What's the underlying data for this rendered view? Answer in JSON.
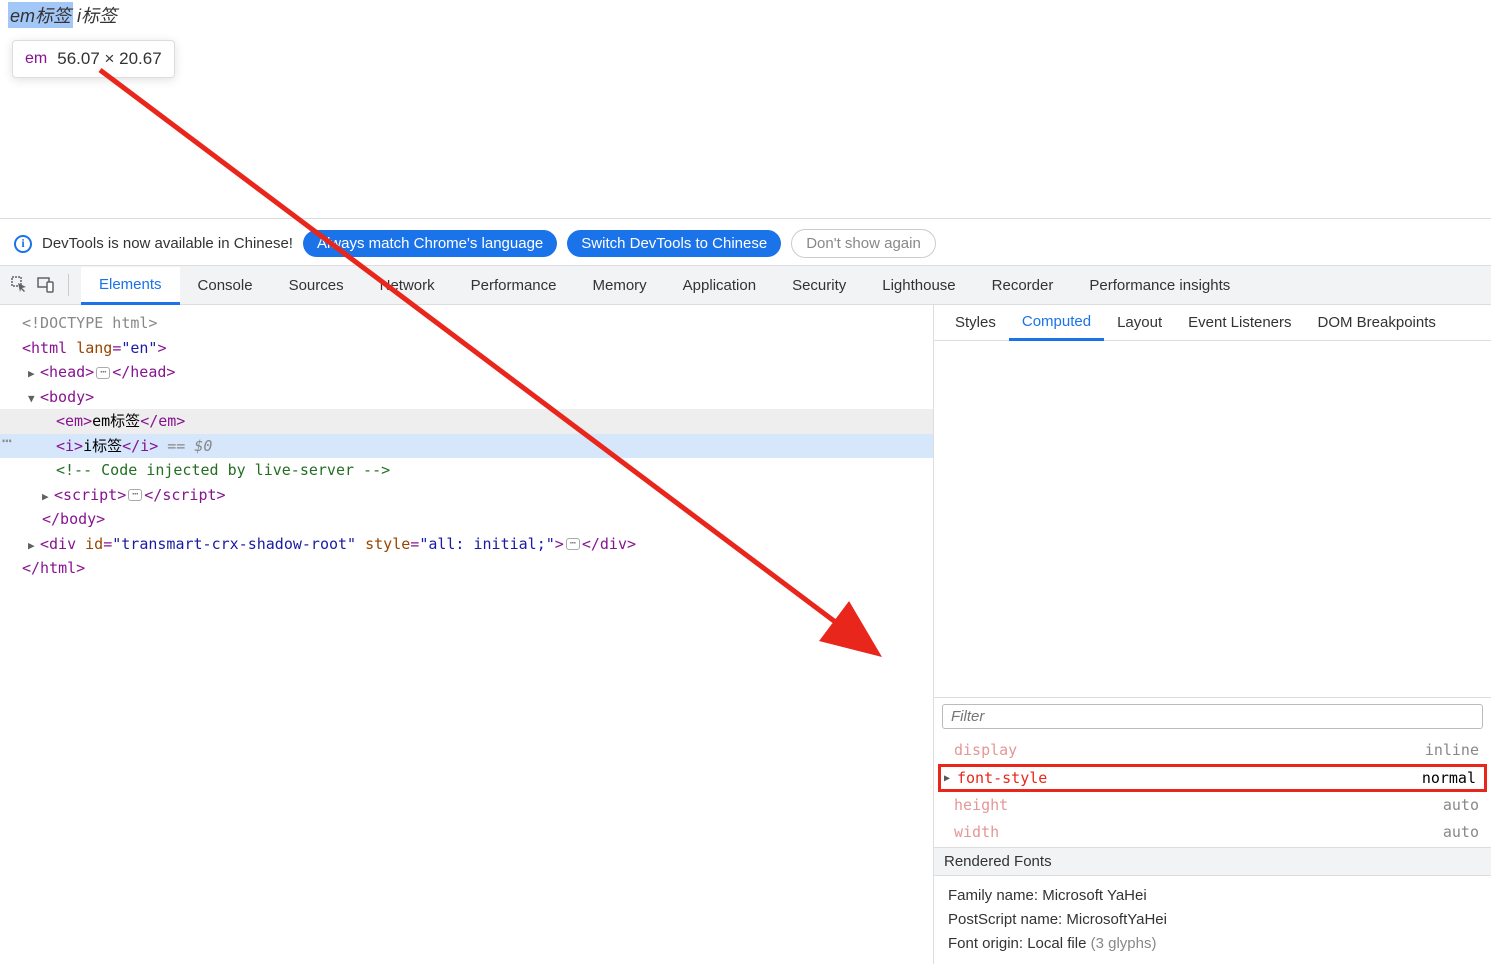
{
  "page": {
    "em_text": "em标签",
    "i_text": "i标签"
  },
  "tooltip": {
    "tag": "em",
    "dims": "56.07 × 20.67"
  },
  "banner": {
    "msg": "DevTools is now available in Chinese!",
    "btn1": "Always match Chrome's language",
    "btn2": "Switch DevTools to Chinese",
    "btn3": "Don't show again"
  },
  "main_tabs": [
    "Elements",
    "Console",
    "Sources",
    "Network",
    "Performance",
    "Memory",
    "Application",
    "Security",
    "Lighthouse",
    "Recorder",
    "Performance insights"
  ],
  "main_tab_active": 0,
  "dom": {
    "l0": "<!DOCTYPE html>",
    "l1_open": "<html ",
    "l1_attr_n": "lang",
    "l1_attr_v": "\"en\"",
    "l1_close": ">",
    "l2_head_o": "<head>",
    "l2_head_c": "</head>",
    "l3_body_o": "<body>",
    "l4_em_o": "<em>",
    "l4_em_t": "em标签",
    "l4_em_c": "</em>",
    "l5_i_o": "<i>",
    "l5_i_t": "i标签",
    "l5_i_c": "</i>",
    "l5_eq": " == ",
    "l5_d": "$0",
    "l6_comment": "<!-- Code injected by live-server -->",
    "l7_script_o": "<script>",
    "l7_script_c": "</script>",
    "l8_body_c": "</body>",
    "l9_div_o": "<div ",
    "l9_a1n": "id",
    "l9_a1v": "\"transmart-crx-shadow-root\"",
    "l9_a2n": "style",
    "l9_a2v": "\"all: initial;\"",
    "l9_div_c": ">",
    "l9_div_e": "</div>",
    "l10_html_c": "</html>"
  },
  "sub_tabs": [
    "Styles",
    "Computed",
    "Layout",
    "Event Listeners",
    "DOM Breakpoints"
  ],
  "sub_tab_active": 1,
  "filter_placeholder": "Filter",
  "computed_props": [
    {
      "name": "display",
      "value": "inline",
      "hl": false,
      "expand": false
    },
    {
      "name": "font-style",
      "value": "normal",
      "hl": true,
      "expand": true
    },
    {
      "name": "height",
      "value": "auto",
      "hl": false,
      "expand": false
    },
    {
      "name": "width",
      "value": "auto",
      "hl": false,
      "expand": false
    }
  ],
  "fonts": {
    "header": "Rendered Fonts",
    "family_lbl": "Family name: ",
    "family_val": "Microsoft YaHei",
    "ps_lbl": "PostScript name: ",
    "ps_val": "MicrosoftYaHei",
    "origin_lbl": "Font origin: ",
    "origin_val": "Local file ",
    "origin_g": "(3 glyphs)"
  }
}
